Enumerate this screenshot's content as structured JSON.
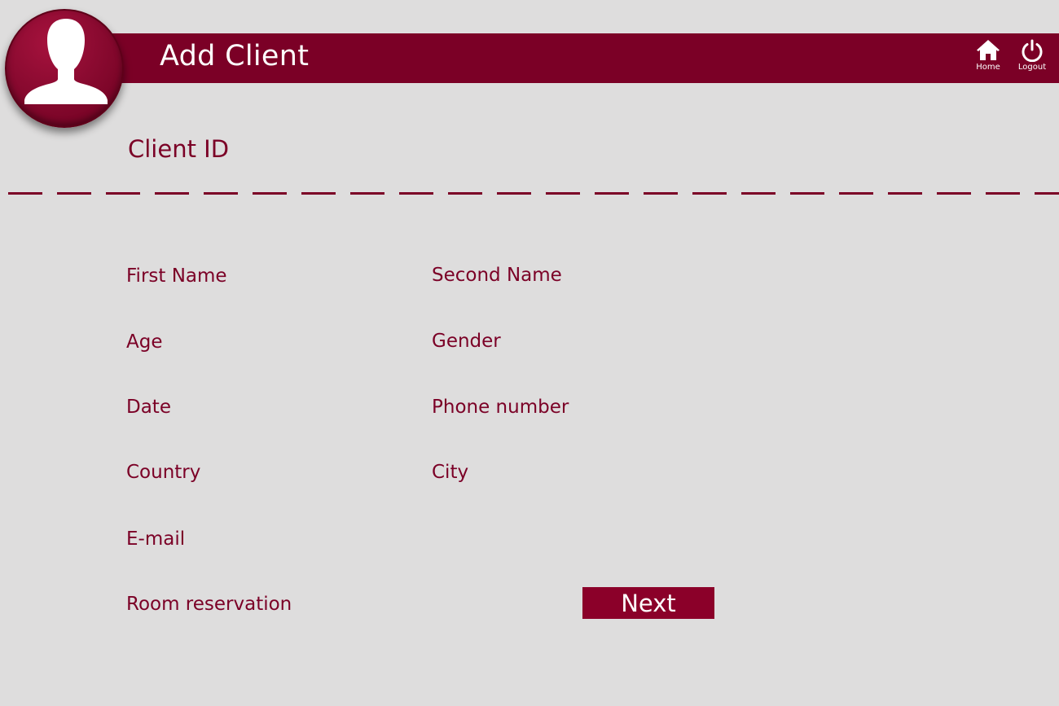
{
  "header": {
    "title": "Add Client",
    "avatar_icon": "user-silhouette-icon",
    "nav": {
      "home_label": "Home",
      "home_icon": "home-icon",
      "logout_label": "Logout",
      "logout_icon": "power-icon"
    }
  },
  "form": {
    "client_id_label": "Client ID",
    "fields": {
      "first_name": "First Name",
      "second_name": "Second Name",
      "age": "Age",
      "gender": "Gender",
      "date": "Date",
      "phone_number": "Phone number",
      "country": "Country",
      "city": "City",
      "email": "E-mail",
      "room_reservation": "Room reservation"
    },
    "next_label": "Next"
  },
  "colors": {
    "background": "#dedddd",
    "brand": "#7b0026",
    "button": "#8b0029",
    "text_on_brand": "#ffffff"
  }
}
